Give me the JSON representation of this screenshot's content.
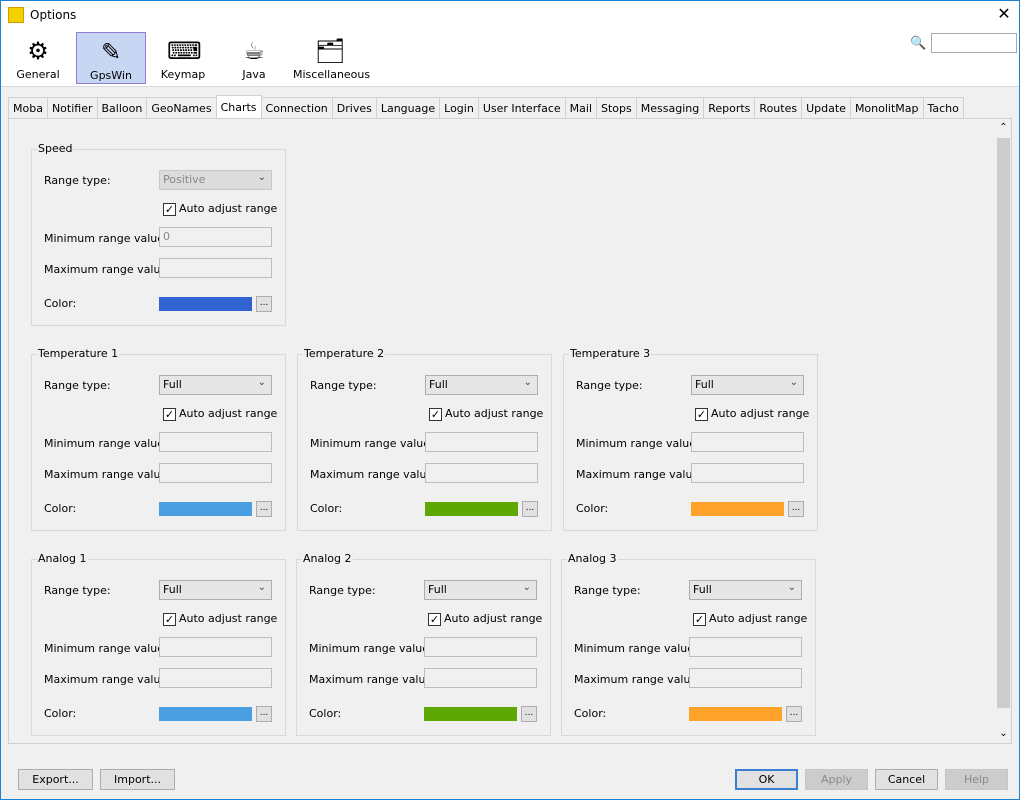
{
  "window": {
    "title": "Options",
    "close": "✕"
  },
  "toolbar": [
    {
      "label": "General",
      "icon": "wrench-gear-icon",
      "glyph": "⚙",
      "selected": false
    },
    {
      "label": "GpsWin",
      "icon": "screwdriver-pen-icon",
      "glyph": "✎",
      "selected": true
    },
    {
      "label": "Keymap",
      "icon": "keyboard-keys-icon",
      "glyph": "⌨",
      "selected": false
    },
    {
      "label": "Java",
      "icon": "java-logo-icon",
      "glyph": "☕",
      "selected": false
    },
    {
      "label": "Miscellaneous",
      "icon": "folder-gear-icon",
      "glyph": "🗂",
      "selected": false
    }
  ],
  "search": {
    "icon": "search-icon",
    "value": ""
  },
  "tabs": [
    "Moba",
    "Notifier",
    "Balloon",
    "GeoNames",
    "Charts",
    "Connection",
    "Drives",
    "Language",
    "Login",
    "User Interface",
    "Mail",
    "Stops",
    "Messaging",
    "Reports",
    "Routes",
    "Update",
    "MonolitMap",
    "Tacho"
  ],
  "selected_tab": "Charts",
  "labels": {
    "range_type": "Range type:",
    "auto_adjust": "Auto adjust range",
    "min": "Minimum range value:",
    "max": "Maximum range value:",
    "color": "Color:",
    "browse": "..."
  },
  "groups": [
    {
      "title": "Speed",
      "range_type": "Positive",
      "range_enabled": false,
      "auto_adjust": true,
      "min": "0",
      "max": "",
      "color": "#2f63cf"
    },
    {
      "title": "Temperature 1",
      "range_type": "Full",
      "range_enabled": true,
      "auto_adjust": true,
      "min": "",
      "max": "",
      "color": "#4a9fe1"
    },
    {
      "title": "Temperature 2",
      "range_type": "Full",
      "range_enabled": true,
      "auto_adjust": true,
      "min": "",
      "max": "",
      "color": "#5fa704"
    },
    {
      "title": "Temperature 3",
      "range_type": "Full",
      "range_enabled": true,
      "auto_adjust": true,
      "min": "",
      "max": "",
      "color": "#ffa229"
    },
    {
      "title": "Analog 1",
      "range_type": "Full",
      "range_enabled": true,
      "auto_adjust": true,
      "min": "",
      "max": "",
      "color": "#4a9fe1"
    },
    {
      "title": "Analog 2",
      "range_type": "Full",
      "range_enabled": true,
      "auto_adjust": true,
      "min": "",
      "max": "",
      "color": "#5fa704"
    },
    {
      "title": "Analog 3",
      "range_type": "Full",
      "range_enabled": true,
      "auto_adjust": true,
      "min": "",
      "max": "",
      "color": "#ffa229"
    }
  ],
  "buttons": {
    "export": "Export...",
    "import": "Import...",
    "ok": "OK",
    "apply": "Apply",
    "cancel": "Cancel",
    "help": "Help"
  }
}
